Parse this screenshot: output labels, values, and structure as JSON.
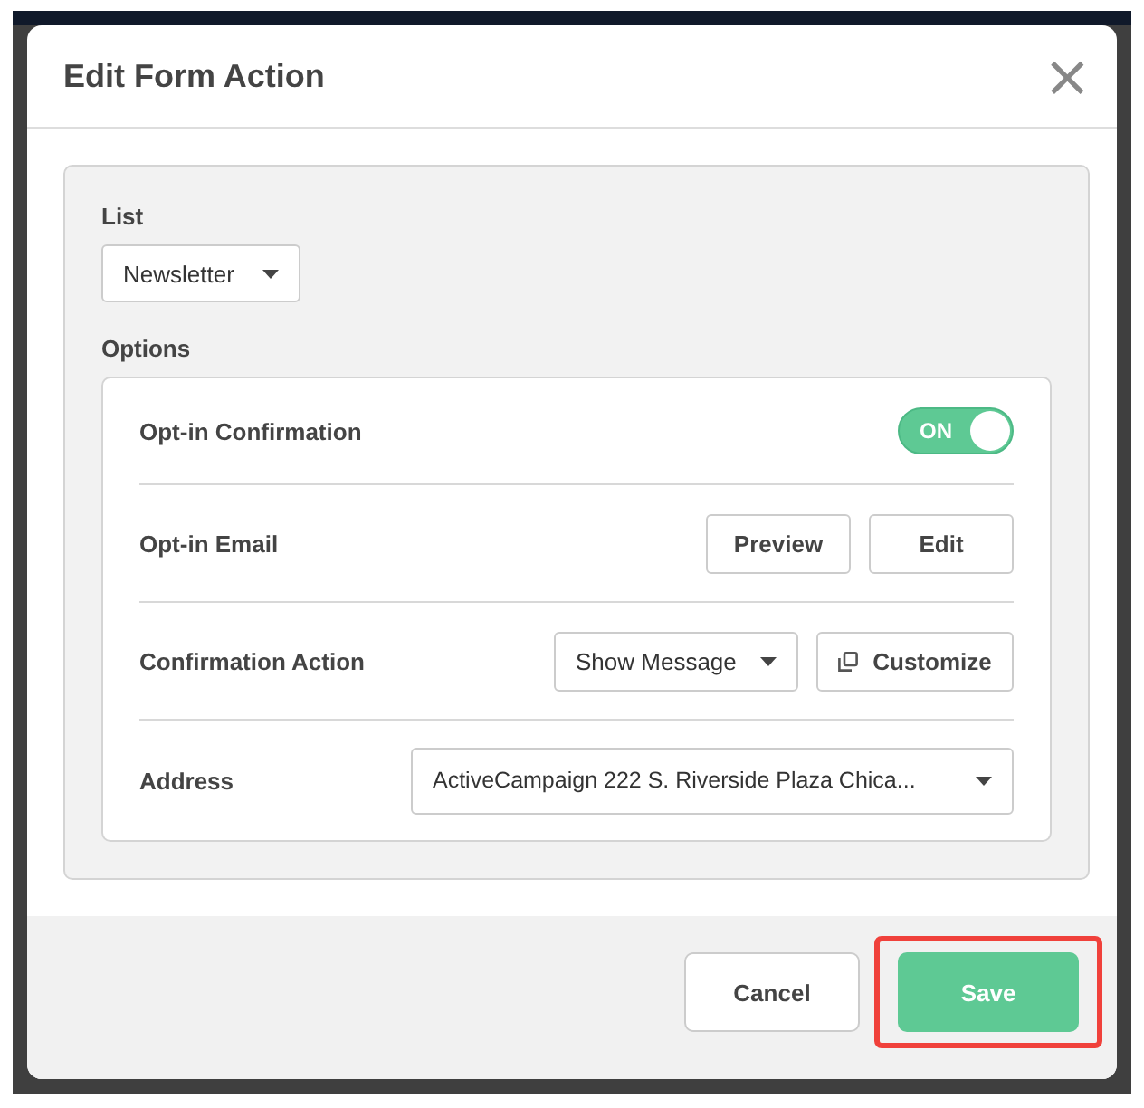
{
  "dialog": {
    "title": "Edit Form Action",
    "close_icon": "×"
  },
  "list": {
    "label": "List",
    "value": "Newsletter"
  },
  "options": {
    "label": "Options",
    "rows": [
      {
        "kind": "toggle",
        "label": "Opt-in Confirmation",
        "on": true,
        "toggle_text": "ON"
      },
      {
        "kind": "buttons",
        "label": "Opt-in Email",
        "buttons": [
          "Preview",
          "Edit"
        ]
      },
      {
        "kind": "select_button",
        "label": "Confirmation Action",
        "value": "Show Message",
        "button": "Customize"
      },
      {
        "kind": "wide_select",
        "label": "Address",
        "value": "ActiveCampaign 222 S. Riverside Plaza Chica..."
      }
    ]
  },
  "footer": {
    "buttons": [
      {
        "label": "Cancel",
        "kind": "secondary",
        "highlighted": false
      },
      {
        "label": "Save",
        "kind": "primary",
        "highlighted": true
      }
    ]
  }
}
